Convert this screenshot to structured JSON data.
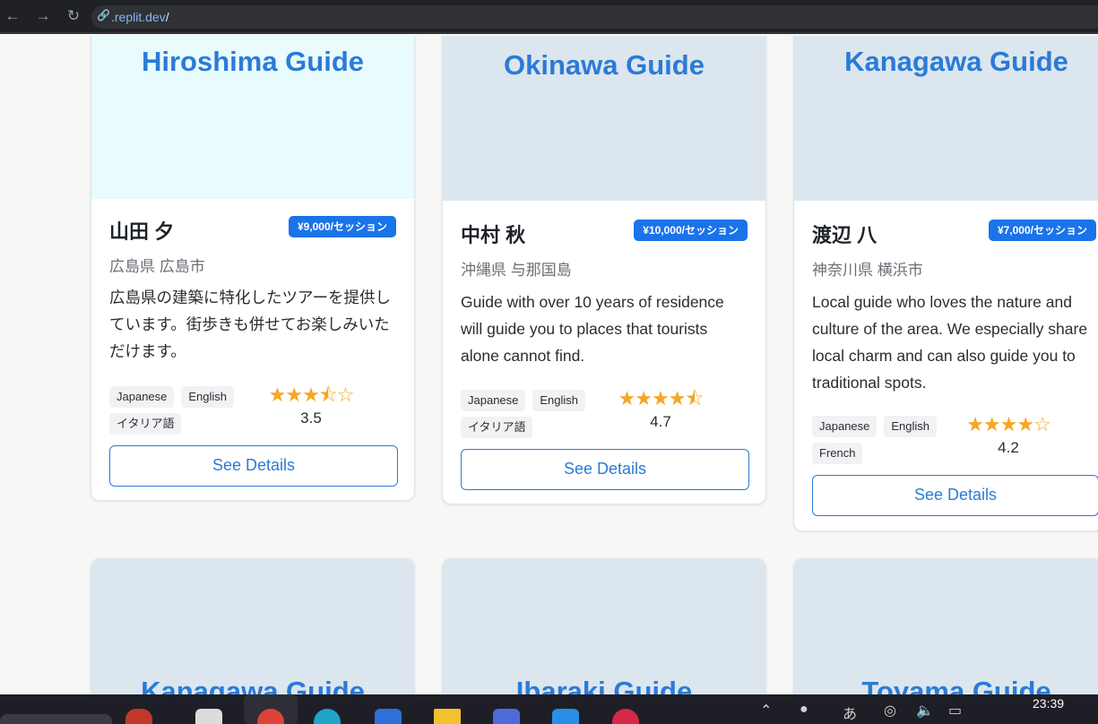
{
  "browser": {
    "url_domain": ".replit.dev",
    "url_path": "/",
    "back_icon": "arrow-left-icon",
    "forward_icon": "arrow-right-icon",
    "reload_icon": "reload-icon"
  },
  "colors": {
    "accent": "#2b7bd6",
    "badge": "#1a73e8",
    "star": "#f5a623",
    "card_image_default": "#dce6ef",
    "card_image_highlight": "#e8fbfd"
  },
  "cards": [
    {
      "title": "Hiroshima Guide",
      "name": "山田 夕",
      "price": "¥9,000/セッション",
      "location": "広島県 広島市",
      "description": "広島県の建築に特化したツアーを提供しています。街歩きも併せてお楽しみいただけます。",
      "languages": [
        "Japanese",
        "English",
        "イタリア語"
      ],
      "stars": "★★★⯪☆",
      "rating": "3.5",
      "button": "See Details"
    },
    {
      "title": "Okinawa Guide",
      "name": "中村 秋",
      "price": "¥10,000/セッション",
      "location": "沖縄県 与那国島",
      "description": "Guide with over 10 years of residence will guide you to places that tourists alone cannot find.",
      "languages": [
        "Japanese",
        "English",
        "イタリア語"
      ],
      "stars": "★★★★⯪",
      "rating": "4.7",
      "button": "See Details"
    },
    {
      "title": "Kanagawa Guide",
      "name": "渡辺 八",
      "price": "¥7,000/セッション",
      "location": "神奈川県 横浜市",
      "description": "Local guide who loves the nature and culture of the area. We especially share local charm and can also guide you to traditional spots.",
      "languages": [
        "Japanese",
        "English",
        "French"
      ],
      "stars": "★★★★☆",
      "rating": "4.2",
      "button": "See Details"
    }
  ],
  "row2": [
    "Kanagawa Guide",
    "Ibaraki Guide",
    "Toyama Guide"
  ],
  "taskbar": {
    "clock": "23:39"
  }
}
